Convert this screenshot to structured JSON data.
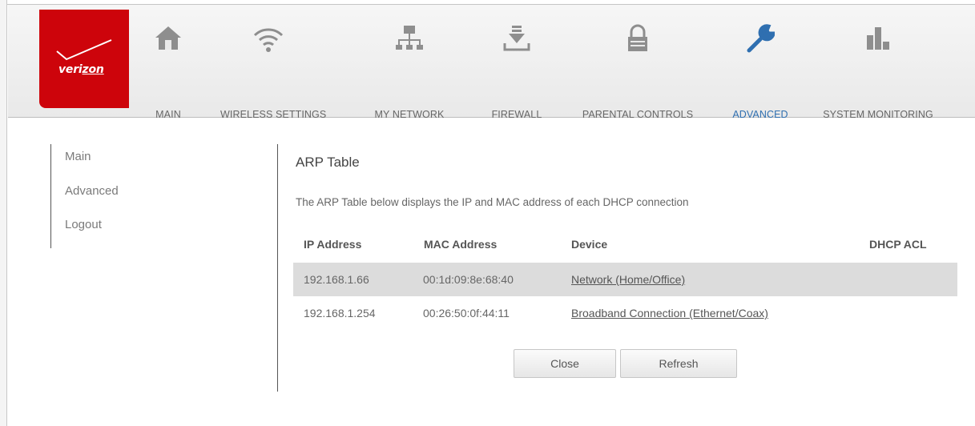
{
  "brand": {
    "name": "verizon",
    "color": "#cd040b"
  },
  "nav": {
    "items": [
      {
        "label": "MAIN",
        "icon": "home-icon",
        "active": false
      },
      {
        "label": "WIRELESS SETTINGS",
        "icon": "wifi-icon",
        "active": false
      },
      {
        "label": "MY NETWORK",
        "icon": "network-icon",
        "active": false
      },
      {
        "label": "FIREWALL",
        "icon": "firewall-icon",
        "active": false
      },
      {
        "label": "PARENTAL CONTROLS",
        "icon": "lock-icon",
        "active": false
      },
      {
        "label": "ADVANCED",
        "icon": "wrench-icon",
        "active": true
      },
      {
        "label": "SYSTEM MONITORING",
        "icon": "bar-chart-icon",
        "active": false
      }
    ],
    "active_color": "#2f6fb0"
  },
  "sidebar": {
    "items": [
      {
        "label": "Main"
      },
      {
        "label": "Advanced"
      },
      {
        "label": "Logout"
      }
    ]
  },
  "page": {
    "title": "ARP Table",
    "description": "The ARP Table below displays the IP and MAC address of each DHCP connection"
  },
  "table": {
    "headers": [
      "IP Address",
      "MAC Address",
      "Device",
      "DHCP ACL"
    ],
    "rows": [
      {
        "ip": "192.168.1.66",
        "mac": "00:1d:09:8e:68:40",
        "device": "Network (Home/Office)",
        "acl": ""
      },
      {
        "ip": "192.168.1.254",
        "mac": "00:26:50:0f:44:11",
        "device": "Broadband Connection (Ethernet/Coax)",
        "acl": ""
      }
    ]
  },
  "buttons": {
    "close": "Close",
    "refresh": "Refresh"
  }
}
